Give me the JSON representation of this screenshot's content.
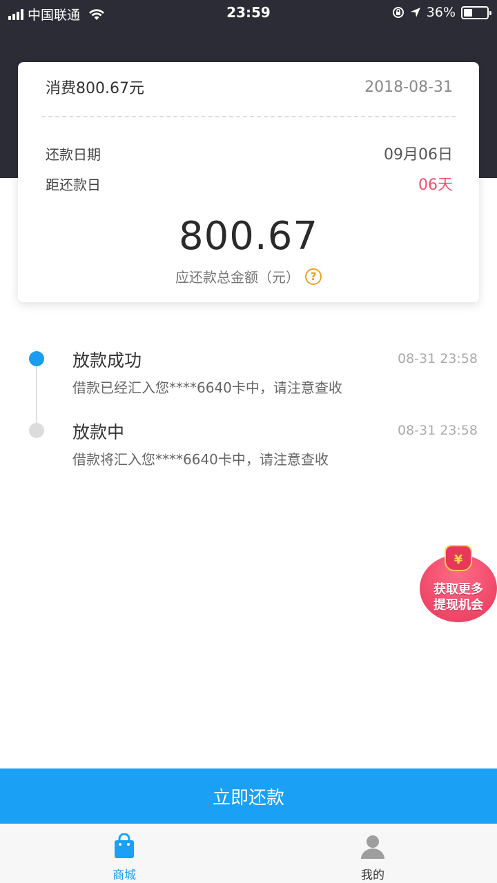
{
  "status_bar": {
    "carrier": "中国联通",
    "time": "23:59",
    "battery": "36%"
  },
  "bill": {
    "title": "消费800.67元",
    "date": "2018-08-31",
    "repay_date_label": "还款日期",
    "repay_date_value": "09月06日",
    "days_left_label": "距还款日",
    "days_left_value": "06天",
    "amount": "800.67",
    "amount_label": "应还款总金额（元）",
    "help_icon": "question-circle-icon",
    "accent_color": "#f0a020",
    "due_color": "#f0506e"
  },
  "timeline": [
    {
      "title": "放款成功",
      "time": "08-31 23:58",
      "desc": "借款已经汇入您****6640卡中，请注意查收",
      "active": true
    },
    {
      "title": "放款中",
      "time": "08-31 23:58",
      "desc": "借款将汇入您****6640卡中，请注意查收",
      "active": false
    }
  ],
  "promo": {
    "line1": "获取更多",
    "line2": "提现机会",
    "symbol": "¥"
  },
  "actions": {
    "repay_button": "立即还款",
    "primary_color": "#1aa0f5"
  },
  "tabbar": {
    "items": [
      {
        "label": "商城",
        "icon": "shopping-bag-icon",
        "active": true
      },
      {
        "label": "我的",
        "icon": "user-icon",
        "active": false
      }
    ]
  }
}
